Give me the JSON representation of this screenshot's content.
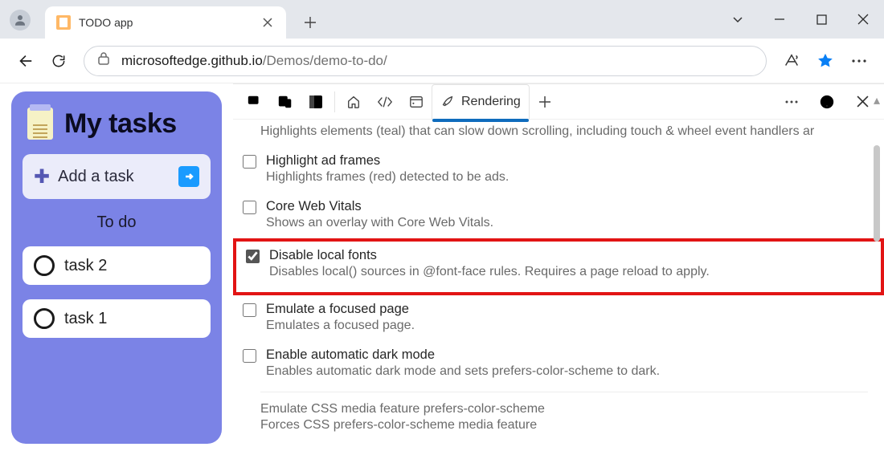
{
  "tab": {
    "title": "TODO app"
  },
  "address": {
    "host": "microsoftedge.github.io",
    "path": "/Demos/demo-to-do/"
  },
  "app": {
    "title": "My tasks",
    "add_label": "Add a task",
    "section": "To do",
    "tasks": [
      "task 2",
      "task 1"
    ]
  },
  "devtools": {
    "active_tab": "Rendering",
    "truncated_top": "Highlights elements (teal) that can slow down scrolling, including touch & wheel event handlers ar",
    "options": [
      {
        "label": "Highlight ad frames",
        "desc": "Highlights frames (red) detected to be ads.",
        "checked": false,
        "highlight": false
      },
      {
        "label": "Core Web Vitals",
        "desc": "Shows an overlay with Core Web Vitals.",
        "checked": false,
        "highlight": false
      },
      {
        "label": "Disable local fonts",
        "desc": "Disables local() sources in @font-face rules. Requires a page reload to apply.",
        "checked": true,
        "highlight": true
      },
      {
        "label": "Emulate a focused page",
        "desc": "Emulates a focused page.",
        "checked": false,
        "highlight": false
      },
      {
        "label": "Enable automatic dark mode",
        "desc": "Enables automatic dark mode and sets prefers-color-scheme to dark.",
        "checked": false,
        "highlight": false
      }
    ],
    "footer": {
      "line1": "Emulate CSS media feature prefers-color-scheme",
      "line2": "Forces CSS prefers-color-scheme media feature"
    }
  }
}
